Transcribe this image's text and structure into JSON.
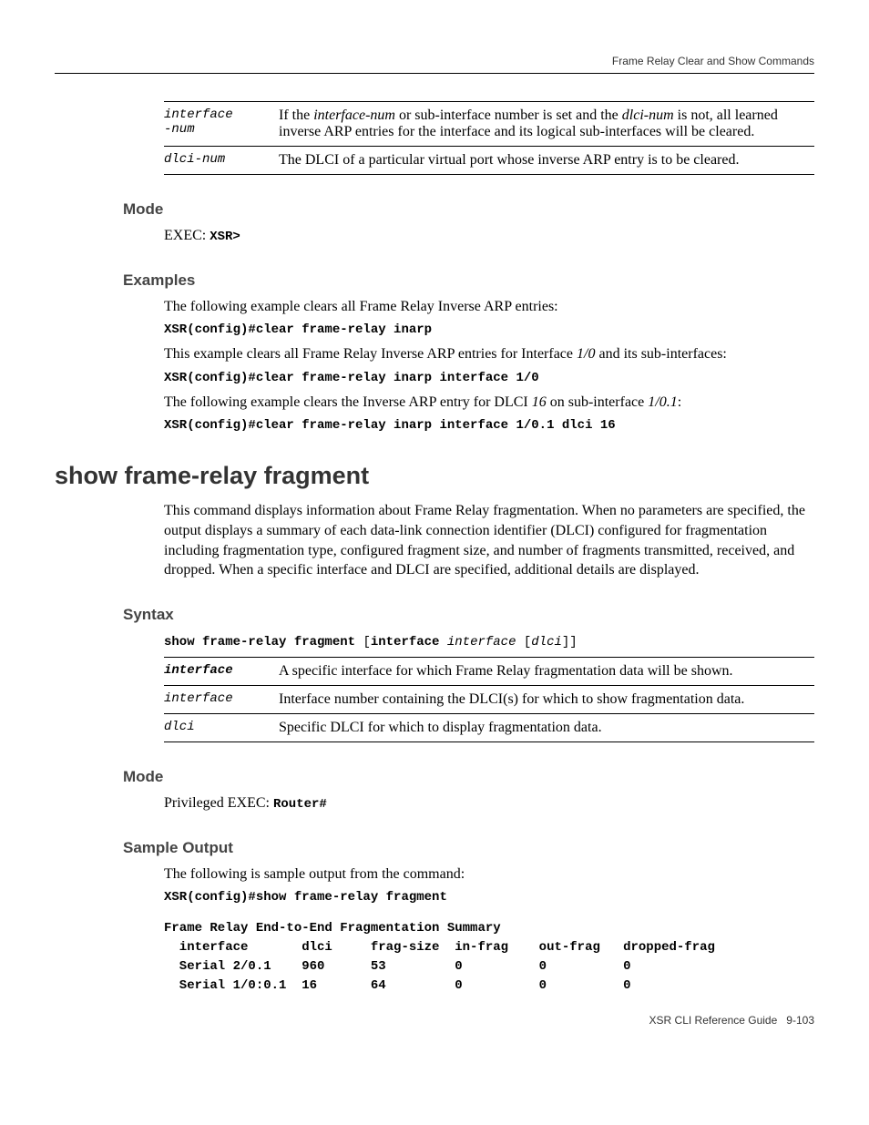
{
  "header": {
    "section": "Frame Relay Clear and Show Commands"
  },
  "paramtable1": {
    "rows": [
      {
        "name": "interface-num",
        "name_html": "interface\n-num",
        "desc_prefix": "If the ",
        "desc_ital1": "interface-num",
        "desc_mid": " or sub-interface number is set and the ",
        "desc_ital2": "dlci-num",
        "desc_suffix": " is not, all learned inverse ARP entries for the interface and its logical sub-interfaces will be cleared."
      },
      {
        "name": "dlci-num",
        "desc": "The DLCI of a particular virtual port whose inverse ARP entry is to be cleared."
      }
    ]
  },
  "mode1": {
    "heading": "Mode",
    "text": "EXEC: ",
    "code": "XSR>"
  },
  "examples": {
    "heading": "Examples",
    "line1": "The following example clears all Frame Relay Inverse ARP entries:",
    "cmd1": "XSR(config)#clear frame-relay inarp",
    "line2a": "This example clears all Frame Relay Inverse ARP entries for Interface ",
    "line2b_ital": "1/0",
    "line2c": " and its sub-interfaces:",
    "cmd2": "XSR(config)#clear frame-relay inarp interface 1/0",
    "line3a": "The following example clears the Inverse ARP entry for DLCI ",
    "line3b_ital": "16",
    "line3c": " on sub-interface ",
    "line3d_ital": "1/0.1",
    "line3e": ":",
    "cmd3": "XSR(config)#clear frame-relay inarp interface 1/0.1 dlci 16"
  },
  "cmd": {
    "title": "show frame-relay fragment",
    "desc": "This command displays information about Frame Relay fragmentation. When no parameters are specified, the output displays a summary of each data-link connection identifier (DLCI) configured for fragmentation including fragmentation type, configured fragment size, and number of fragments transmitted, received, and dropped. When a specific interface and DLCI are specified, additional details are displayed."
  },
  "syntax": {
    "heading": "Syntax",
    "p1": "show frame-relay fragment ",
    "p2": "[",
    "p3": "interface ",
    "p4": "interface ",
    "p5": "[",
    "p6": "dlci",
    "p7": "]]",
    "rows": [
      {
        "name": "interface",
        "bold": true,
        "desc": "A specific interface for which Frame Relay fragmentation data will be shown."
      },
      {
        "name": "interface",
        "bold": false,
        "desc": "Interface number containing the DLCI(s) for which to show fragmentation data."
      },
      {
        "name": "dlci",
        "bold": false,
        "desc": "Specific DLCI for which to display fragmentation data."
      }
    ]
  },
  "mode2": {
    "heading": "Mode",
    "text": "Privileged EXEC: ",
    "code": "Router#"
  },
  "sample": {
    "heading": "Sample Output",
    "intro": "The following is sample output from the command:",
    "cmd": "XSR(config)#show frame-relay fragment",
    "output": "Frame Relay End-to-End Fragmentation Summary\n  interface       dlci     frag-size  in-frag    out-frag   dropped-frag\n  Serial 2/0.1    960      53         0          0          0\n  Serial 1/0:0.1  16       64         0          0          0"
  },
  "footer": {
    "left": "XSR CLI Reference Guide",
    "right": "9-103"
  }
}
